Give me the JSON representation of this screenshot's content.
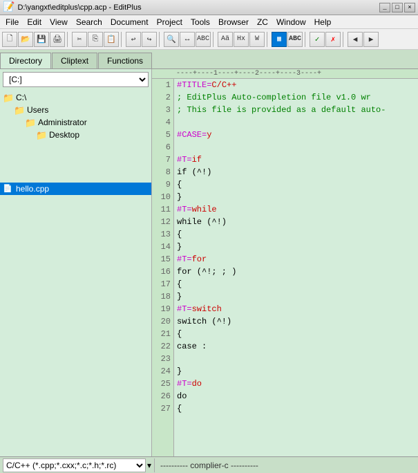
{
  "titlebar": {
    "text": "D:\\yangxt\\editplus\\cpp.acp - EditPlus",
    "buttons": [
      "_",
      "□",
      "×"
    ]
  },
  "menubar": {
    "items": [
      "File",
      "Edit",
      "View",
      "Search",
      "Document",
      "Project",
      "Tools",
      "Browser",
      "ZC",
      "Window",
      "Help"
    ]
  },
  "toolbar": {
    "buttons": [
      "📄",
      "📂",
      "💾",
      "🖨",
      "✂",
      "📋",
      "📄",
      "↩",
      "↪",
      "🔍",
      "A",
      "ABC",
      "🔤",
      "A",
      "Hx",
      "W",
      "▦",
      "ABC",
      "✓",
      "✗",
      "◀",
      "▶"
    ]
  },
  "tabs": {
    "items": [
      "Directory",
      "Cliptext",
      "Functions"
    ]
  },
  "sidebar": {
    "drive": "[C:]",
    "tree": [
      {
        "label": "C:\\",
        "level": 0,
        "type": "folder"
      },
      {
        "label": "Users",
        "level": 1,
        "type": "folder"
      },
      {
        "label": "Administrator",
        "level": 2,
        "type": "folder"
      },
      {
        "label": "Desktop",
        "level": 3,
        "type": "folder"
      }
    ],
    "file": "hello.cpp"
  },
  "ruler": {
    "text": "----+----1----+----2----+----3----+"
  },
  "code": {
    "lines": [
      {
        "n": 1,
        "tokens": [
          {
            "t": "#TITLE=",
            "c": "hash"
          },
          {
            "t": "C/C++",
            "c": "red"
          }
        ]
      },
      {
        "n": 2,
        "tokens": [
          {
            "t": "; EditPlus Auto-completion file v1.0 wr",
            "c": "comment"
          }
        ]
      },
      {
        "n": 3,
        "tokens": [
          {
            "t": "; This file is provided as a default auto-",
            "c": "comment"
          }
        ]
      },
      {
        "n": 4,
        "tokens": []
      },
      {
        "n": 5,
        "tokens": [
          {
            "t": "#CASE=",
            "c": "hash"
          },
          {
            "t": "y",
            "c": "red"
          }
        ]
      },
      {
        "n": 6,
        "tokens": []
      },
      {
        "n": 7,
        "tokens": [
          {
            "t": "#T=",
            "c": "hash"
          },
          {
            "t": "if",
            "c": "red"
          }
        ]
      },
      {
        "n": 8,
        "tokens": [
          {
            "t": "if (^!)",
            "c": "plain"
          }
        ]
      },
      {
        "n": 9,
        "tokens": [
          {
            "t": "{",
            "c": "plain"
          }
        ]
      },
      {
        "n": 10,
        "tokens": [
          {
            "t": "}",
            "c": "plain"
          }
        ]
      },
      {
        "n": 11,
        "tokens": [
          {
            "t": "#T=",
            "c": "hash"
          },
          {
            "t": "while",
            "c": "red"
          }
        ]
      },
      {
        "n": 12,
        "tokens": [
          {
            "t": "while (^!)",
            "c": "plain"
          }
        ]
      },
      {
        "n": 13,
        "tokens": [
          {
            "t": "{",
            "c": "plain"
          }
        ]
      },
      {
        "n": 14,
        "tokens": [
          {
            "t": "}",
            "c": "plain"
          }
        ]
      },
      {
        "n": 15,
        "tokens": [
          {
            "t": "#T=",
            "c": "hash"
          },
          {
            "t": "for",
            "c": "red"
          }
        ]
      },
      {
        "n": 16,
        "tokens": [
          {
            "t": "for (^!; ; )",
            "c": "plain"
          }
        ]
      },
      {
        "n": 17,
        "tokens": [
          {
            "t": "{",
            "c": "plain"
          }
        ]
      },
      {
        "n": 18,
        "tokens": [
          {
            "t": "}",
            "c": "plain"
          }
        ]
      },
      {
        "n": 19,
        "tokens": [
          {
            "t": "#T=",
            "c": "hash"
          },
          {
            "t": "switch",
            "c": "red"
          }
        ]
      },
      {
        "n": 20,
        "tokens": [
          {
            "t": "switch (^!)",
            "c": "plain"
          }
        ]
      },
      {
        "n": 21,
        "tokens": [
          {
            "t": "{",
            "c": "plain"
          }
        ]
      },
      {
        "n": 22,
        "tokens": [
          {
            "t": "case :",
            "c": "plain"
          }
        ]
      },
      {
        "n": 23,
        "tokens": []
      },
      {
        "n": 24,
        "tokens": [
          {
            "t": "}",
            "c": "plain"
          }
        ]
      },
      {
        "n": 25,
        "tokens": [
          {
            "t": "#T=",
            "c": "hash"
          },
          {
            "t": "do",
            "c": "red"
          }
        ]
      },
      {
        "n": 26,
        "tokens": [
          {
            "t": "do",
            "c": "plain"
          }
        ]
      },
      {
        "n": 27,
        "tokens": [
          {
            "t": "{",
            "c": "plain"
          }
        ]
      }
    ]
  },
  "statusbar": {
    "file_type": "C/C++ (*.cpp;*.cxx;*.c;*.h;*.rc)",
    "status_text": "---------- complier-c ----------"
  }
}
